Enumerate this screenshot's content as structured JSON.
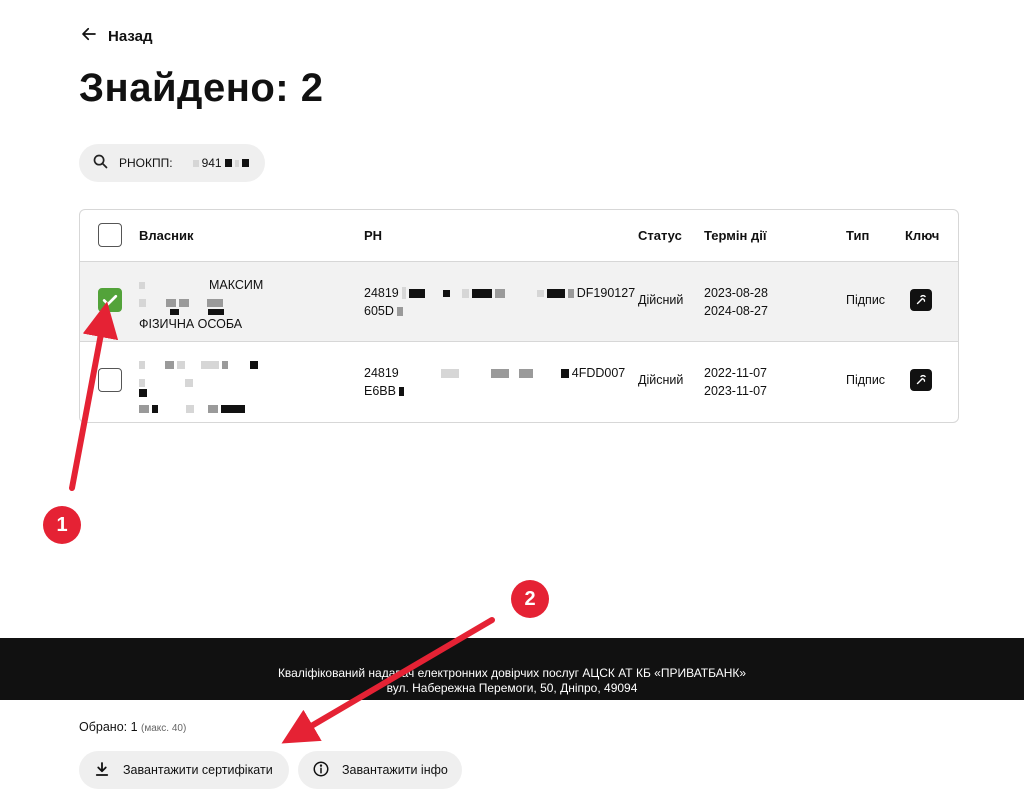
{
  "nav": {
    "back_label": "Назад"
  },
  "title": "Знайдено: 2",
  "search": {
    "label": "РНОКПП:",
    "value_visible": "941"
  },
  "table": {
    "headers": {
      "owner": "Власник",
      "rn": "РН",
      "status": "Статус",
      "term": "Термін дії",
      "type": "Тип",
      "key": "Ключ"
    },
    "rows": [
      {
        "selected": true,
        "owner_name": "МАКСИМ",
        "owner_kind": "ФІЗИЧНА ОСОБА",
        "rn_line1_start": "24819",
        "rn_line1_end": "DF190127",
        "rn_line2_start": "605D",
        "status": "Дійсний",
        "date_from": "2023-08-28",
        "date_to": "2024-08-27",
        "type": "Підпис"
      },
      {
        "selected": false,
        "rn_line1_start": "24819",
        "rn_line1_end": "4FDD007",
        "rn_line2_start": "E6BB",
        "status": "Дійсний",
        "date_from": "2022-11-07",
        "date_to": "2023-11-07",
        "type": "Підпис"
      }
    ]
  },
  "footer": {
    "line1": "Кваліфікований надавач електронних довірчих послуг АЦСК АТ КБ «ПРИВАТБАНК»",
    "line2": "вул. Набережна Перемоги, 50, Дніпро, 49094"
  },
  "selection": {
    "label": "Обрано: 1",
    "max": "(макс. 40)"
  },
  "actions": {
    "download_certs": "Завантажити сертифікати",
    "download_info": "Завантажити інфо"
  },
  "annotations": {
    "marker1": "1",
    "marker2": "2",
    "color": "#e52234"
  },
  "colors": {
    "check_green": "#53a33a",
    "footer_bg": "#111111",
    "chip_bg": "#efefef"
  }
}
